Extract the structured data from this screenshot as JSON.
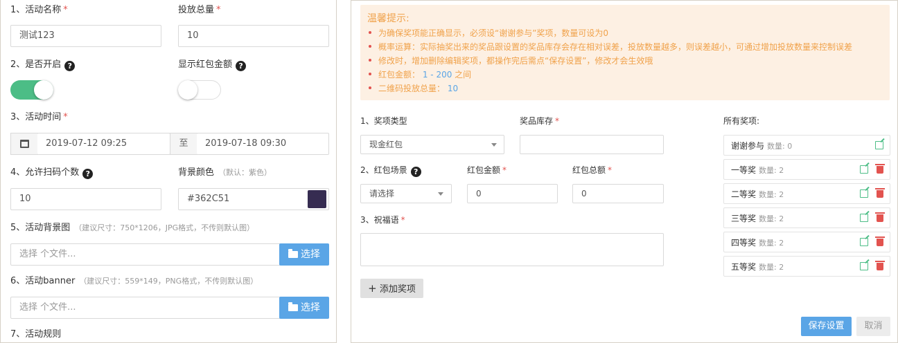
{
  "left": {
    "activity_name": {
      "label": "1、活动名称",
      "value": "测试123"
    },
    "total_put": {
      "label": "投放总量",
      "value": "10"
    },
    "is_enabled": {
      "label": "2、是否开启",
      "on": true
    },
    "show_amount": {
      "label": "显示红包金额",
      "on": false
    },
    "activity_time": {
      "label": "3、活动时间",
      "start": "2019-07-12 09:25",
      "separator": "至",
      "end": "2019-07-18 09:30"
    },
    "scan_count": {
      "label": "4、允许扫码个数",
      "value": "10"
    },
    "bg_color": {
      "label": "背景颜色",
      "hint": "（默认：紫色）",
      "value": "#362C51",
      "swatch": "#362C51"
    },
    "bg_image": {
      "label": "5、活动背景图",
      "hint": "（建议尺寸：750*1206，JPG格式，不传则默认图）",
      "placeholder": "选择 个文件...",
      "button": "选择"
    },
    "banner": {
      "label": "6、活动banner",
      "hint": "（建议尺寸：559*149，PNG格式，不传则默认图）",
      "placeholder": "选择 个文件...",
      "button": "选择"
    },
    "rules": {
      "label": "7、活动规则"
    },
    "required_mark": "*",
    "help_glyph": "?"
  },
  "right": {
    "tips": {
      "title": "温馨提示:",
      "items": [
        {
          "text": "为确保奖项能正确显示，必须设“谢谢参与”奖项，数量可设为0"
        },
        {
          "text": "概率运算：实际抽奖出来的奖品跟设置的奖品库存会存在相对误差，投放数量越多，则误差越小，可通过增加投放数量来控制误差"
        },
        {
          "text": "修改时，增加删除编辑奖项，都操作完后需点“保存设置”，修改才会生效哦"
        },
        {
          "prefix": "红包金额：",
          "value": "1 - 200",
          "suffix": "之间"
        },
        {
          "prefix": "二维码投放总量：",
          "value": "10",
          "suffix": ""
        }
      ]
    },
    "prize_type": {
      "label": "1、奖项类型",
      "value": "现金红包"
    },
    "stock": {
      "label": "奖品库存",
      "value": ""
    },
    "scene": {
      "label": "2、红包场景",
      "value": "请选择"
    },
    "amount": {
      "label": "红包金额",
      "value": "0"
    },
    "total": {
      "label": "红包总额",
      "value": "0"
    },
    "blessing": {
      "label": "3、祝福语",
      "value": ""
    },
    "add_button": "添加奖项",
    "all_prizes_label": "所有奖项:",
    "prizes": [
      {
        "name": "谢谢参与",
        "count": "数量: 0",
        "deletable": false
      },
      {
        "name": "一等奖",
        "count": "数量: 2",
        "deletable": true
      },
      {
        "name": "二等奖",
        "count": "数量: 2",
        "deletable": true
      },
      {
        "name": "三等奖",
        "count": "数量: 2",
        "deletable": true
      },
      {
        "name": "四等奖",
        "count": "数量: 2",
        "deletable": true
      },
      {
        "name": "五等奖",
        "count": "数量: 2",
        "deletable": true
      }
    ],
    "save_button": "保存设置",
    "cancel_button": "取消"
  },
  "colors": {
    "accent": "#5aa5e6",
    "toggle_on": "#4cbd86",
    "warning": "#f0a24b",
    "danger": "#e2534f"
  }
}
